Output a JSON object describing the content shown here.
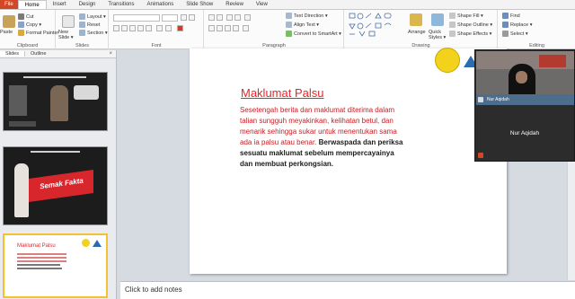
{
  "tabs": [
    "File",
    "Home",
    "Insert",
    "Design",
    "Transitions",
    "Animations",
    "Slide Show",
    "Review",
    "View"
  ],
  "ribbon": {
    "clipboard": {
      "paste": "Paste",
      "cut": "Cut",
      "copy": "Copy ▾",
      "format_painter": "Format Painter",
      "label": "Clipboard"
    },
    "slides": {
      "new_slide": "New Slide ▾",
      "layout": "Layout ▾",
      "reset": "Reset",
      "section": "Section ▾",
      "label": "Slides"
    },
    "font": {
      "label": "Font"
    },
    "paragraph": {
      "text_direction": "Text Direction ▾",
      "align_text": "Align Text ▾",
      "convert_smartart": "Convert to SmartArt ▾",
      "label": "Paragraph"
    },
    "drawing": {
      "arrange": "Arrange",
      "quick_styles": "Quick Styles ▾",
      "shape_fill": "Shape Fill ▾",
      "shape_outline": "Shape Outline ▾",
      "shape_effects": "Shape Effects ▾",
      "label": "Drawing"
    },
    "editing": {
      "find": "Find",
      "replace": "Replace ▾",
      "select": "Select ▾",
      "label": "Editing"
    }
  },
  "left_pane": {
    "tab_slides": "Slides",
    "tab_outline": "Outline",
    "close": "×",
    "numbers": [
      "",
      "",
      ""
    ],
    "thumb2_text": "Semak Fakta",
    "thumb3_title": "Maklumat Palsu"
  },
  "slide": {
    "title": "Maklumat Palsu",
    "body_normal": "Sesetengah berita dan maklumat diterima dalam talian sungguh meyakinkan, kelihatan betul, dan menarik sehingga sukar untuk menentukan sama ada ia palsu atau benar.",
    "body_bold": "Berwaspada dan periksa sesuatu maklumat sebelum mempercayainya dan membuat perkongsian."
  },
  "notes_placeholder": "Click to add notes",
  "video": {
    "camera_label": "Nur Aqidah",
    "participant_name": "Nur Aqidah"
  },
  "colors": {
    "accent": "#d24726",
    "title_red": "#e4252a",
    "body_red": "#c51d23"
  }
}
